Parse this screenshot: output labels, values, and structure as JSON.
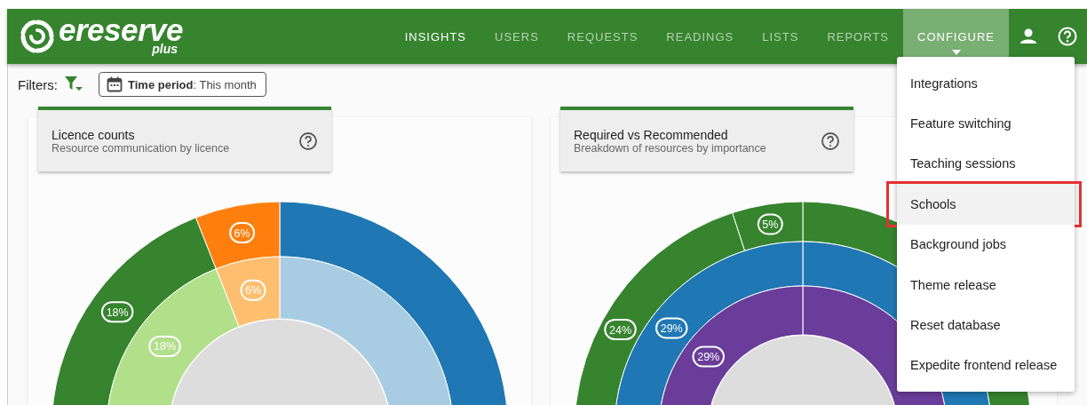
{
  "header": {
    "logo": {
      "name": "ereserve",
      "suffix": "plus"
    },
    "nav": [
      {
        "label": "INSIGHTS",
        "selected": false,
        "active": true
      },
      {
        "label": "USERS",
        "selected": false,
        "active": false
      },
      {
        "label": "REQUESTS",
        "selected": false,
        "active": false
      },
      {
        "label": "READINGS",
        "selected": false,
        "active": false
      },
      {
        "label": "LISTS",
        "selected": false,
        "active": false
      },
      {
        "label": "REPORTS",
        "selected": false,
        "active": false
      },
      {
        "label": "CONFIGURE",
        "selected": true,
        "active": true
      }
    ]
  },
  "filters": {
    "label": "Filters:",
    "time_period": {
      "name": "Time period",
      "value": ": This month"
    }
  },
  "charts": [
    {
      "title": "Licence counts",
      "subtitle": "Resource communication by licence",
      "rings": [
        {
          "segments": [
            {
              "color": "#1f77b4"
            },
            {
              "label": "6%",
              "color": "#ff7f0e"
            },
            {
              "label": "18%",
              "color": "#36842e"
            }
          ]
        },
        {
          "segments": [
            {
              "color": "#a8cde2"
            },
            {
              "label": "6%",
              "color": "#fdbf6f"
            },
            {
              "label": "18%",
              "color": "#b2df8a"
            }
          ]
        }
      ]
    },
    {
      "title": "Required vs Recommended",
      "subtitle": "Breakdown of resources by importance",
      "rings": [
        {
          "segments": [
            {
              "color": "#36842e"
            },
            {
              "label": "5%",
              "color": "#36842e"
            },
            {
              "label": "24%",
              "color": "#36842e"
            }
          ]
        },
        {
          "segments": [
            {
              "color": "#1f77b4"
            },
            {
              "label": "29%",
              "color": "#1f77b4"
            }
          ]
        },
        {
          "segments": [
            {
              "color": "#6a3d9a"
            },
            {
              "label": "29%",
              "color": "#6a3d9a"
            }
          ]
        }
      ]
    }
  ],
  "menu": [
    {
      "label": "Integrations",
      "highlighted": false
    },
    {
      "label": "Feature switching",
      "highlighted": false
    },
    {
      "label": "Teaching sessions",
      "highlighted": false
    },
    {
      "label": "Schools",
      "highlighted": true
    },
    {
      "label": "Background jobs",
      "highlighted": false
    },
    {
      "label": "Theme release",
      "highlighted": false
    },
    {
      "label": "Reset database",
      "highlighted": false
    },
    {
      "label": "Expedite frontend release",
      "highlighted": false
    }
  ]
}
